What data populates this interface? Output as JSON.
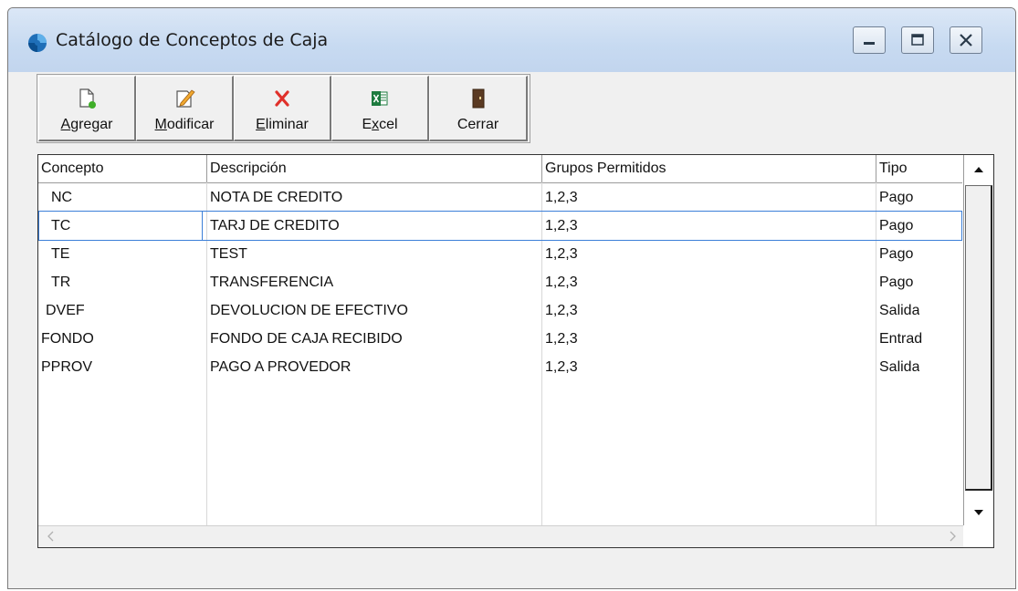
{
  "window": {
    "title": "Catálogo de Conceptos de Caja",
    "icon": "app-logo-icon",
    "controls": [
      "minimize-icon",
      "restore-icon",
      "close-icon"
    ]
  },
  "toolbar": {
    "agregar": {
      "pre": "",
      "acc": "A",
      "post": "gregar",
      "icon": "new-document-icon"
    },
    "modificar": {
      "pre": "",
      "acc": "M",
      "post": "odificar",
      "icon": "edit-pencil-icon"
    },
    "eliminar": {
      "pre": "",
      "acc": "E",
      "post": "liminar",
      "icon": "delete-x-icon"
    },
    "excel": {
      "pre": "E",
      "acc": "x",
      "post": "cel",
      "icon": "excel-icon"
    },
    "cerrar": {
      "pre": "Cerrar",
      "acc": "",
      "post": "",
      "icon": "exit-door-icon"
    }
  },
  "table": {
    "headers": [
      "Concepto",
      "Descripción",
      "Grupos Permitidos",
      "Tipo"
    ],
    "rows": [
      {
        "concepto": "NC",
        "descripcion": "NOTA DE CREDITO",
        "grupos": "1,2,3",
        "tipo": "Pago"
      },
      {
        "concepto": "TC",
        "descripcion": "TARJ DE CREDITO",
        "grupos": "1,2,3",
        "tipo": "Pago"
      },
      {
        "concepto": "TE",
        "descripcion": "TEST",
        "grupos": "1,2,3",
        "tipo": "Pago"
      },
      {
        "concepto": "TR",
        "descripcion": "TRANSFERENCIA",
        "grupos": "1,2,3",
        "tipo": "Pago"
      },
      {
        "concepto": "DVEF",
        "descripcion": "DEVOLUCION DE EFECTIVO",
        "grupos": "1,2,3",
        "tipo": "Salida"
      },
      {
        "concepto": "FONDO",
        "descripcion": "FONDO DE CAJA RECIBIDO",
        "grupos": "1,2,3",
        "tipo": "Entrad"
      },
      {
        "concepto": "PPROV",
        "descripcion": "PAGO A PROVEDOR",
        "grupos": "1,2,3",
        "tipo": "Salida"
      }
    ],
    "selected_row": 1
  },
  "colors": {
    "selection_border": "#3c7fd8",
    "window_bg": "#f0f0f0",
    "titlebar": "#c7daf1"
  }
}
